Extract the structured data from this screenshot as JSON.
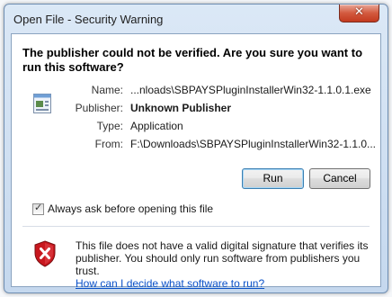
{
  "window": {
    "title": "Open File - Security Warning",
    "close_glyph": "✕"
  },
  "dialog": {
    "headline": "The publisher could not be verified.  Are you sure you want to run this software?",
    "icon": "application-file-icon",
    "details": [
      {
        "label": "Name:",
        "value": "...nloads\\SBPAYSPluginInstallerWin32-1.1.0.1.exe",
        "bold": false
      },
      {
        "label": "Publisher:",
        "value": "Unknown Publisher",
        "bold": true
      },
      {
        "label": "Type:",
        "value": "Application",
        "bold": false
      },
      {
        "label": "From:",
        "value": "F:\\Downloads\\SBPAYSPluginInstallerWin32-1.1.0...",
        "bold": false
      }
    ],
    "run_label": "Run",
    "cancel_label": "Cancel",
    "checkbox": {
      "label": "Always ask before opening this file",
      "checked": true,
      "glyph": "✓"
    },
    "warning": {
      "icon": "shield-error-icon",
      "text": "This file does not have a valid digital signature that verifies its publisher.  You should only run software from publishers you trust.",
      "link": "How can I decide what software to run?"
    }
  },
  "colors": {
    "link": "#0a51c8",
    "shield_red": "#c8171e",
    "default_button_border": "#3c7fb1"
  }
}
